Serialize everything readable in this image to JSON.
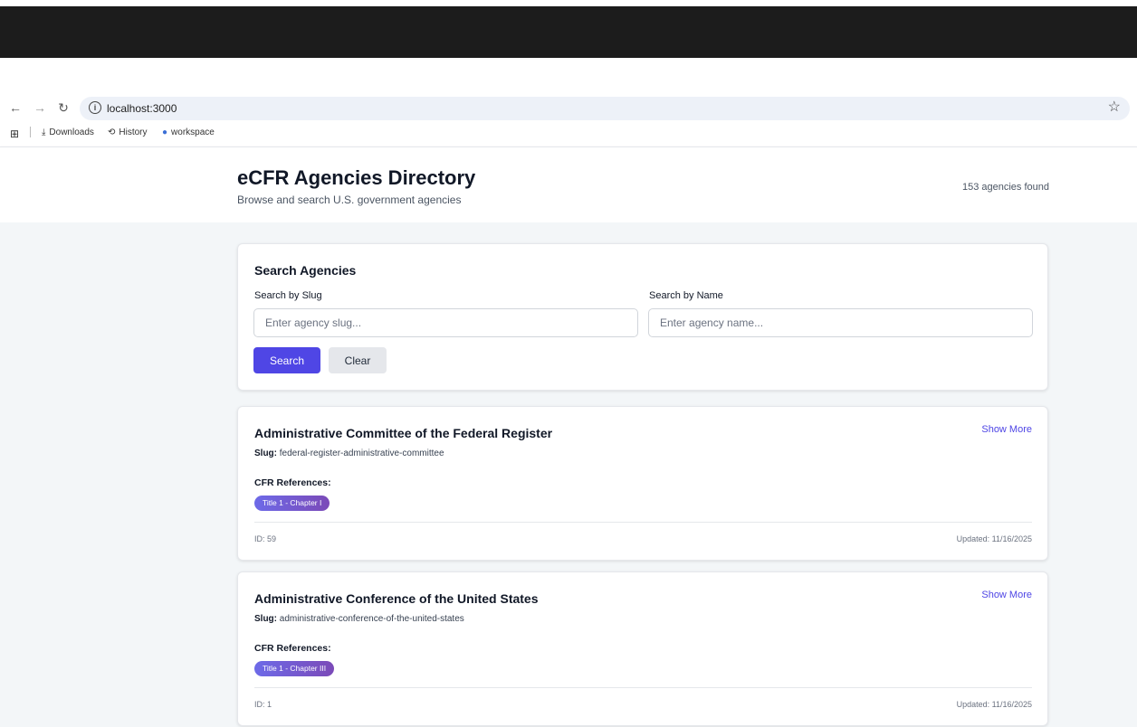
{
  "browser": {
    "url": "localhost:3000",
    "bookmarks": [
      {
        "label": "Downloads",
        "icon": "download-icon"
      },
      {
        "label": "History",
        "icon": "history-icon"
      },
      {
        "label": "workspace",
        "icon": "globe-icon"
      }
    ]
  },
  "header": {
    "title": "eCFR Agencies Directory",
    "subtitle": "Browse and search U.S. government agencies",
    "count": "153 agencies found"
  },
  "search": {
    "title": "Search Agencies",
    "slug_label": "Search by Slug",
    "slug_placeholder": "Enter agency slug...",
    "name_label": "Search by Name",
    "name_placeholder": "Enter agency name...",
    "search_button": "Search",
    "clear_button": "Clear"
  },
  "labels": {
    "show_more": "Show More",
    "slug_prefix": "Slug:",
    "cfr_refs": "CFR References:"
  },
  "agencies": [
    {
      "name": "Administrative Committee of the Federal Register",
      "slug": "federal-register-administrative-committee",
      "ref": "Title 1 - Chapter I",
      "id": "ID: 59",
      "updated": "Updated: 11/16/2025"
    },
    {
      "name": "Administrative Conference of the United States",
      "slug": "administrative-conference-of-the-united-states",
      "ref": "Title 1 - Chapter III",
      "id": "ID: 1",
      "updated": "Updated: 11/16/2025"
    }
  ],
  "colors": {
    "accent": "#4f46e5",
    "page_bg": "#f3f6f8",
    "badge_start": "#6d6ae8",
    "badge_end": "#7b4ab8"
  }
}
